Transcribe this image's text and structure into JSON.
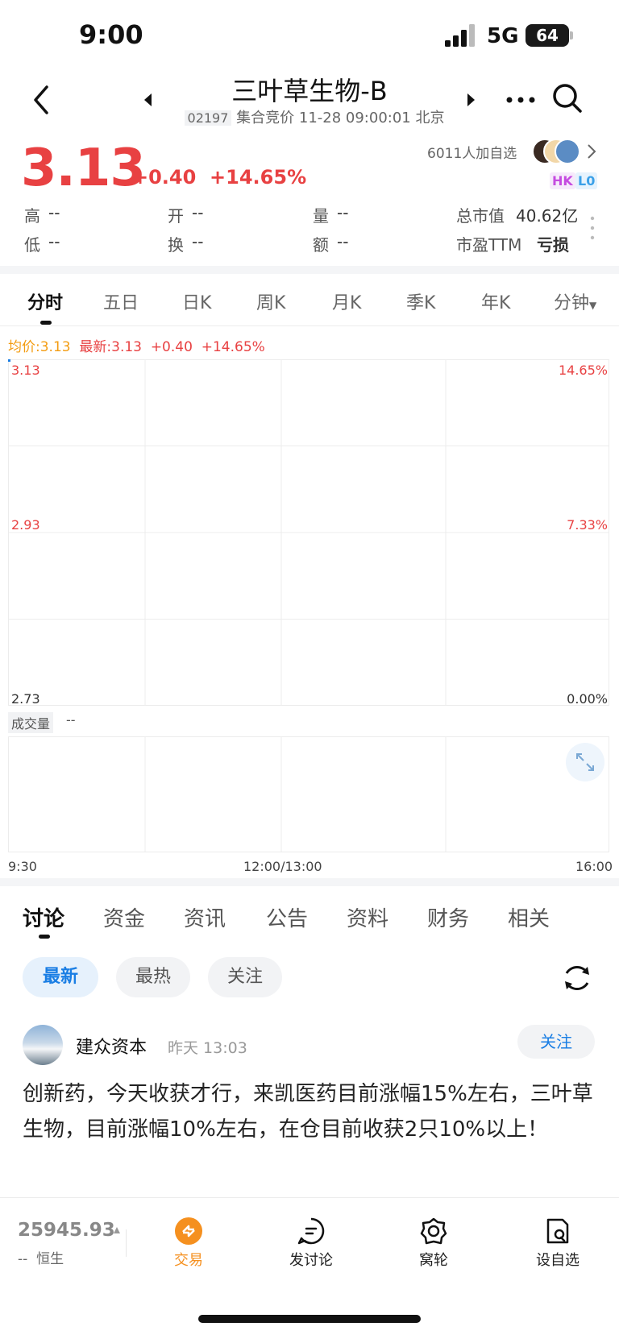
{
  "status": {
    "time": "9:00",
    "network": "5G",
    "battery": "64"
  },
  "header": {
    "title": "三叶草生物-B",
    "code": "02197",
    "session": "集合竞价 11-28 09:00:01 北京"
  },
  "quote": {
    "price": "3.13",
    "change": "+0.40",
    "change_pct": "+14.65%",
    "followers": "6011人加自选",
    "badge_hk": "HK",
    "badge_l0": "L0",
    "stats": {
      "high_label": "高",
      "high": "--",
      "low_label": "低",
      "low": "--",
      "open_label": "开",
      "open": "--",
      "turnover_label": "换",
      "turnover": "--",
      "volume_label": "量",
      "volume": "--",
      "amount_label": "额",
      "amount": "--",
      "mcap_label": "总市值",
      "mcap": "40.62亿",
      "pe_label": "市盈TTM",
      "pe": "亏损"
    }
  },
  "chart_tabs": [
    "分时",
    "五日",
    "日K",
    "周K",
    "月K",
    "季K",
    "年K",
    "分钟"
  ],
  "intraday": {
    "avg_label": "均价:3.13",
    "latest_label": "最新:3.13",
    "change": "+0.40",
    "change_pct": "+14.65%",
    "y_left": [
      "3.13",
      "2.93",
      "2.73"
    ],
    "y_right": [
      "14.65%",
      "7.33%",
      "0.00%"
    ],
    "volume_label": "成交量",
    "volume_value": "--",
    "x_labels": [
      "9:30",
      "12:00/13:00",
      "16:00"
    ]
  },
  "colors": {
    "up": "#e84142",
    "accent": "#1a7ee4",
    "orange": "#f39c12"
  },
  "info_tabs": [
    "讨论",
    "资金",
    "资讯",
    "公告",
    "资料",
    "财务",
    "相关"
  ],
  "filters": [
    "最新",
    "最热",
    "关注"
  ],
  "post": {
    "author": "建众资本",
    "time": "昨天 13:03",
    "follow": "关注",
    "text": "创新药，今天收获才行，来凯医药目前涨幅15%左右，三叶草生物，目前涨幅10%左右，在仓目前收获2只10%以上！"
  },
  "bottom_bar": {
    "index_value": "25945.93",
    "index_change": "--",
    "index_name": "恒生",
    "items": [
      "交易",
      "发讨论",
      "窝轮",
      "设自选"
    ]
  }
}
